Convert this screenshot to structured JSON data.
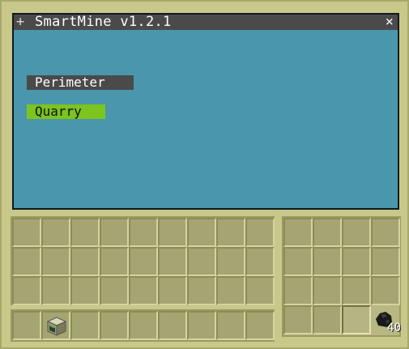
{
  "window": {
    "title": "SmartMine v1.2.1",
    "plus_symbol": "+",
    "close_symbol": "×"
  },
  "buttons": {
    "perimeter": "Perimeter",
    "quarry": "Quarry"
  },
  "colors": {
    "screen_bg": "#4a97ad",
    "titlebar_bg": "#4a4a4a",
    "perimeter_bg": "#4a4a4a",
    "quarry_bg": "#7cc41e",
    "gui_bg": "#c8c88b"
  },
  "inventory": {
    "main_rows": 3,
    "columns": 9,
    "hotbar": {
      "slot_1_icon": "computer-block-icon"
    }
  },
  "turtle_inventory": {
    "fuel_slot": {
      "icon": "coal-icon",
      "count": "40"
    }
  }
}
